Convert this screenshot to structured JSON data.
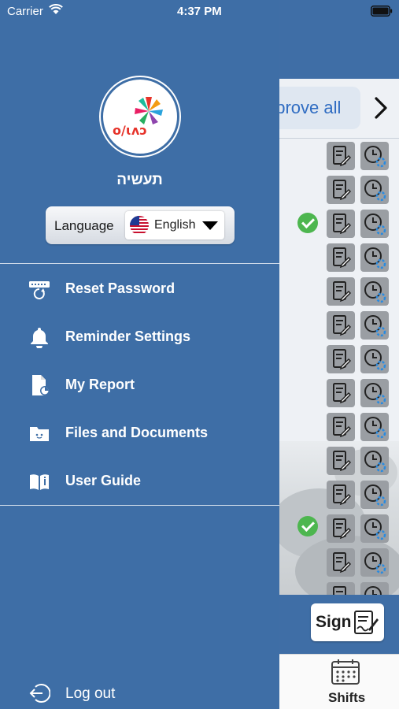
{
  "status_bar": {
    "carrier": "Carrier",
    "time": "4:37 PM"
  },
  "drawer": {
    "org_name": "תעשיה",
    "language": {
      "label": "Language",
      "selected": "English",
      "flag": "us-flag-icon"
    },
    "menu": [
      {
        "label": "Reset Password",
        "icon": "password-icon"
      },
      {
        "label": "Reminder Settings",
        "icon": "bell-icon"
      },
      {
        "label": "My Report",
        "icon": "report-icon"
      },
      {
        "label": "Files and Documents",
        "icon": "folder-icon"
      },
      {
        "label": "User Guide",
        "icon": "book-icon"
      }
    ],
    "logout_label": "Log out"
  },
  "background": {
    "approve_label": "pprove all",
    "sign_label": "Sign",
    "tab_label": "Shifts"
  },
  "colors": {
    "drawer": "#3e6ea6",
    "accent": "#2f6cc2",
    "approved": "#4db64f"
  }
}
